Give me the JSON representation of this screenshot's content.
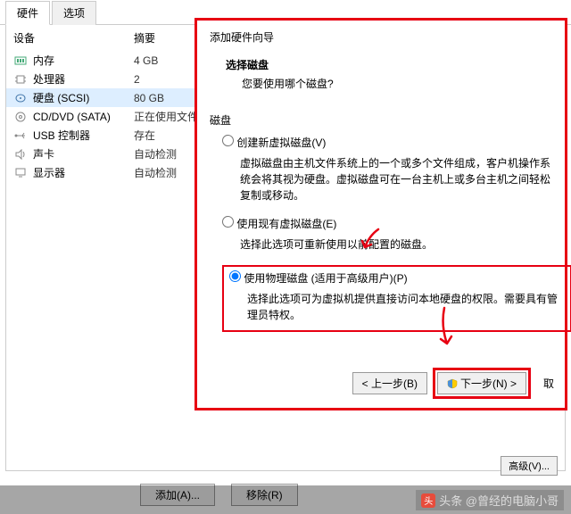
{
  "tabs": {
    "hardware": "硬件",
    "options": "选项"
  },
  "table": {
    "device_header": "设备",
    "summary_header": "摘要"
  },
  "devices": {
    "memory": {
      "name": "内存",
      "summary": "4 GB"
    },
    "cpu": {
      "name": "处理器",
      "summary": "2"
    },
    "disk": {
      "name": "硬盘 (SCSI)",
      "summary": "80 GB"
    },
    "cd": {
      "name": "CD/DVD (SATA)",
      "summary": "正在使用文件"
    },
    "usb": {
      "name": "USB 控制器",
      "summary": "存在"
    },
    "sound": {
      "name": "声卡",
      "summary": "自动检测"
    },
    "display": {
      "name": "显示器",
      "summary": "自动检测"
    }
  },
  "buttons": {
    "add": "添加(A)...",
    "remove": "移除(R)",
    "advanced": "高级(V)..."
  },
  "wizard": {
    "title": "添加硬件向导",
    "select_disk": "选择磁盘",
    "which_disk": "您要使用哪个磁盘?",
    "disk_label": "磁盘",
    "opt_create": "创建新虚拟磁盘(V)",
    "opt_create_desc": "虚拟磁盘由主机文件系统上的一个或多个文件组成，客户机操作系统会将其视为硬盘。虚拟磁盘可在一台主机上或多台主机之间轻松复制或移动。",
    "opt_existing": "使用现有虚拟磁盘(E)",
    "opt_existing_desc": "选择此选项可重新使用以前配置的磁盘。",
    "opt_physical": "使用物理磁盘 (适用于高级用户)(P)",
    "opt_physical_desc": "选择此选项可为虚拟机提供直接访问本地硬盘的权限。需要具有管理员特权。",
    "back": "< 上一步(B)",
    "next": "下一步(N) >",
    "cancel": "取"
  },
  "footer": {
    "text": "头条  @曾经的电脑小哥"
  }
}
